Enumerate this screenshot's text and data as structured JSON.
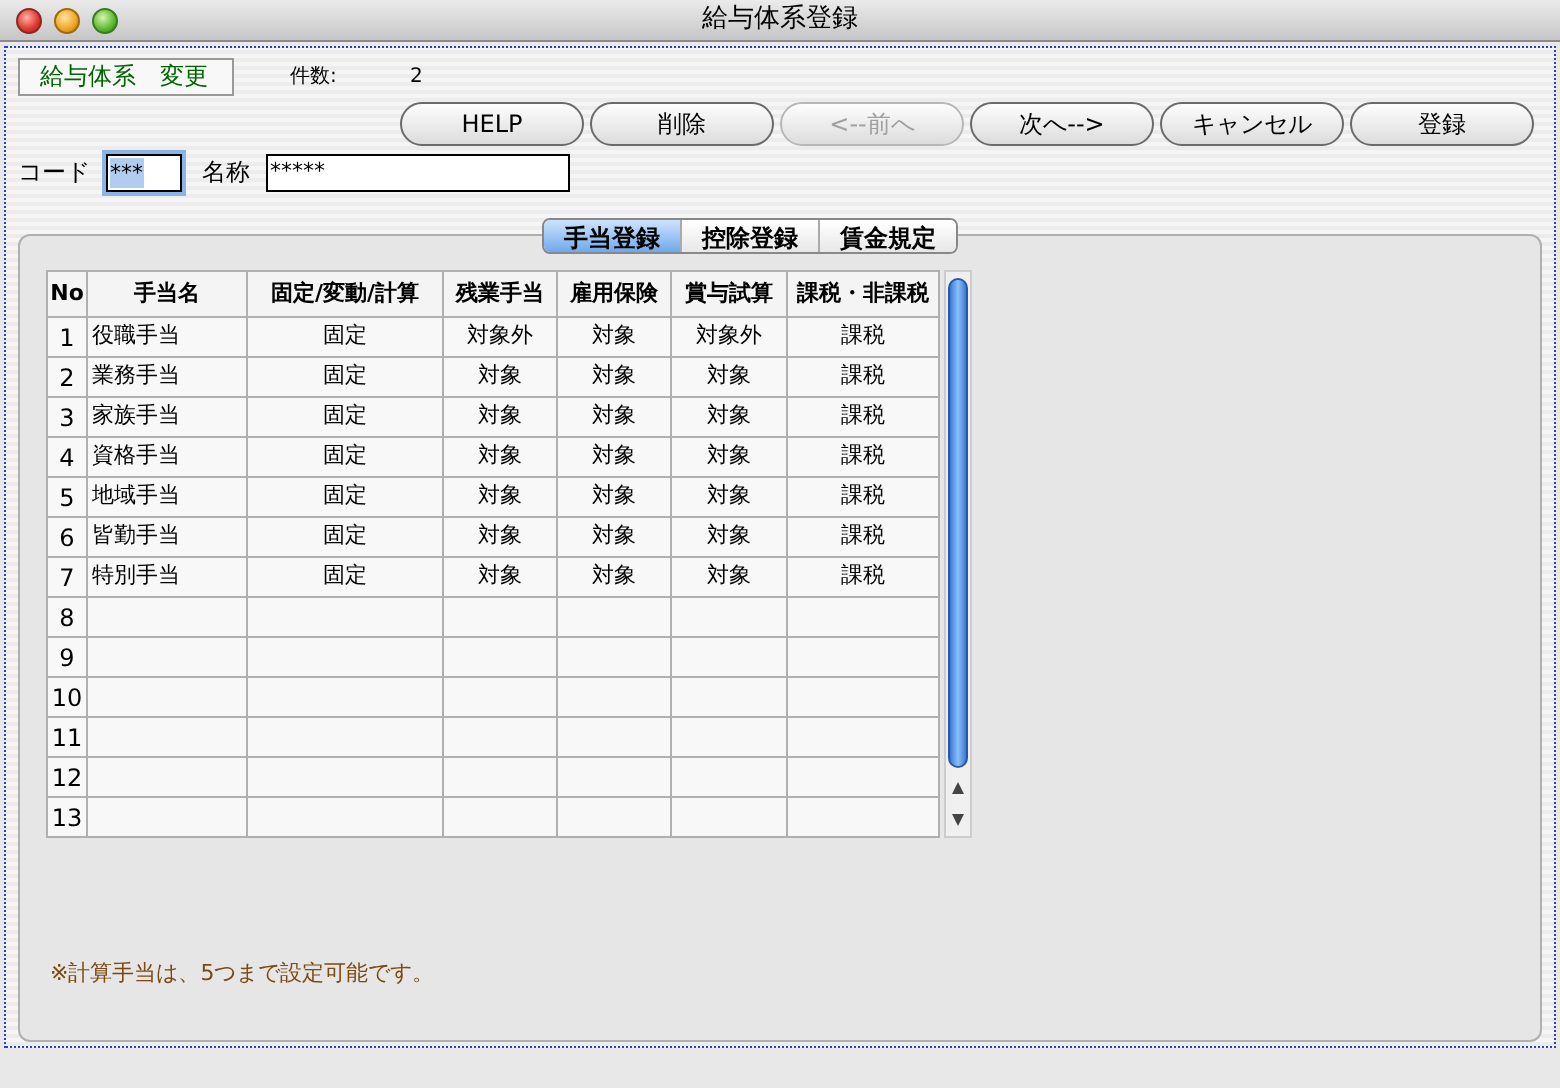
{
  "window": {
    "title": "給与体系登録"
  },
  "mode": "給与体系　変更",
  "count": {
    "label": "件数:",
    "value": "2"
  },
  "buttons": [
    {
      "label": "HELP",
      "disabled": false
    },
    {
      "label": "削除",
      "disabled": false
    },
    {
      "label": "<--前へ",
      "disabled": true
    },
    {
      "label": "次へ-->",
      "disabled": false
    },
    {
      "label": "キャンセル",
      "disabled": false
    },
    {
      "label": "登録",
      "disabled": false
    }
  ],
  "code": {
    "label": "コード",
    "value": "***"
  },
  "name": {
    "label": "名称",
    "value": "*****"
  },
  "tabs": [
    {
      "label": "手当登録",
      "selected": true
    },
    {
      "label": "控除登録",
      "selected": false
    },
    {
      "label": "賃金規定",
      "selected": false
    }
  ],
  "table": {
    "columns": [
      "No",
      "手当名",
      "固定/変動/計算",
      "残業手当",
      "雇用保険",
      "賞与試算",
      "課税・非課税"
    ],
    "rows": [
      {
        "no": "1",
        "cells": [
          "役職手当",
          "固定",
          "対象外",
          "対象",
          "対象外",
          "課税"
        ]
      },
      {
        "no": "2",
        "cells": [
          "業務手当",
          "固定",
          "対象",
          "対象",
          "対象",
          "課税"
        ]
      },
      {
        "no": "3",
        "cells": [
          "家族手当",
          "固定",
          "対象",
          "対象",
          "対象",
          "課税"
        ]
      },
      {
        "no": "4",
        "cells": [
          "資格手当",
          "固定",
          "対象",
          "対象",
          "対象",
          "課税"
        ]
      },
      {
        "no": "5",
        "cells": [
          "地域手当",
          "固定",
          "対象",
          "対象",
          "対象",
          "課税"
        ]
      },
      {
        "no": "6",
        "cells": [
          "皆勤手当",
          "固定",
          "対象",
          "対象",
          "対象",
          "課税"
        ]
      },
      {
        "no": "7",
        "cells": [
          "特別手当",
          "固定",
          "対象",
          "対象",
          "対象",
          "課税"
        ]
      },
      {
        "no": "8"
      },
      {
        "no": "9"
      },
      {
        "no": "10"
      },
      {
        "no": "11"
      },
      {
        "no": "12"
      },
      {
        "no": "13"
      }
    ]
  },
  "note": "※計算手当は、5つまで設定可能です。"
}
